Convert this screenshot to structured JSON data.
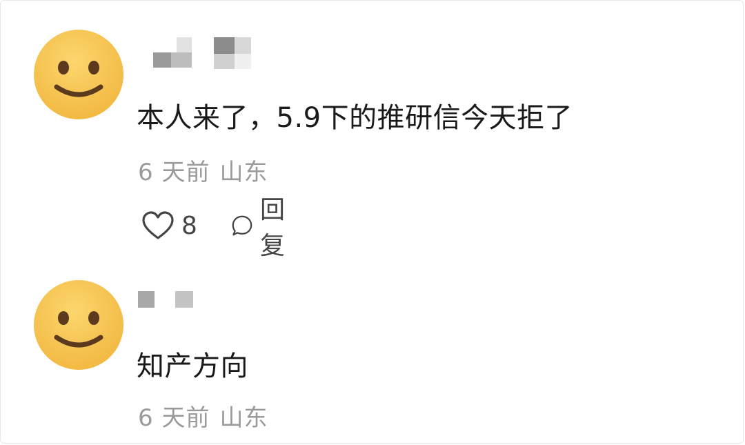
{
  "comments": [
    {
      "avatar_icon": "smiley-face-icon",
      "text": "本人来了，5.9下的推研信今天拒了",
      "time": "6 天前",
      "location": "山东",
      "like_icon": "heart-outline-icon",
      "like_count": "8",
      "reply_icon": "speech-bubble-icon",
      "reply_label": "回复"
    },
    {
      "avatar_icon": "smiley-face-icon",
      "text": "知产方向",
      "time": "6 天前",
      "location": "山东"
    }
  ],
  "colors": {
    "avatar_face": "#f7c65a",
    "avatar_features": "#5b3a1e",
    "body_text": "#1a1a1a",
    "meta_text": "#9a9a9a"
  }
}
